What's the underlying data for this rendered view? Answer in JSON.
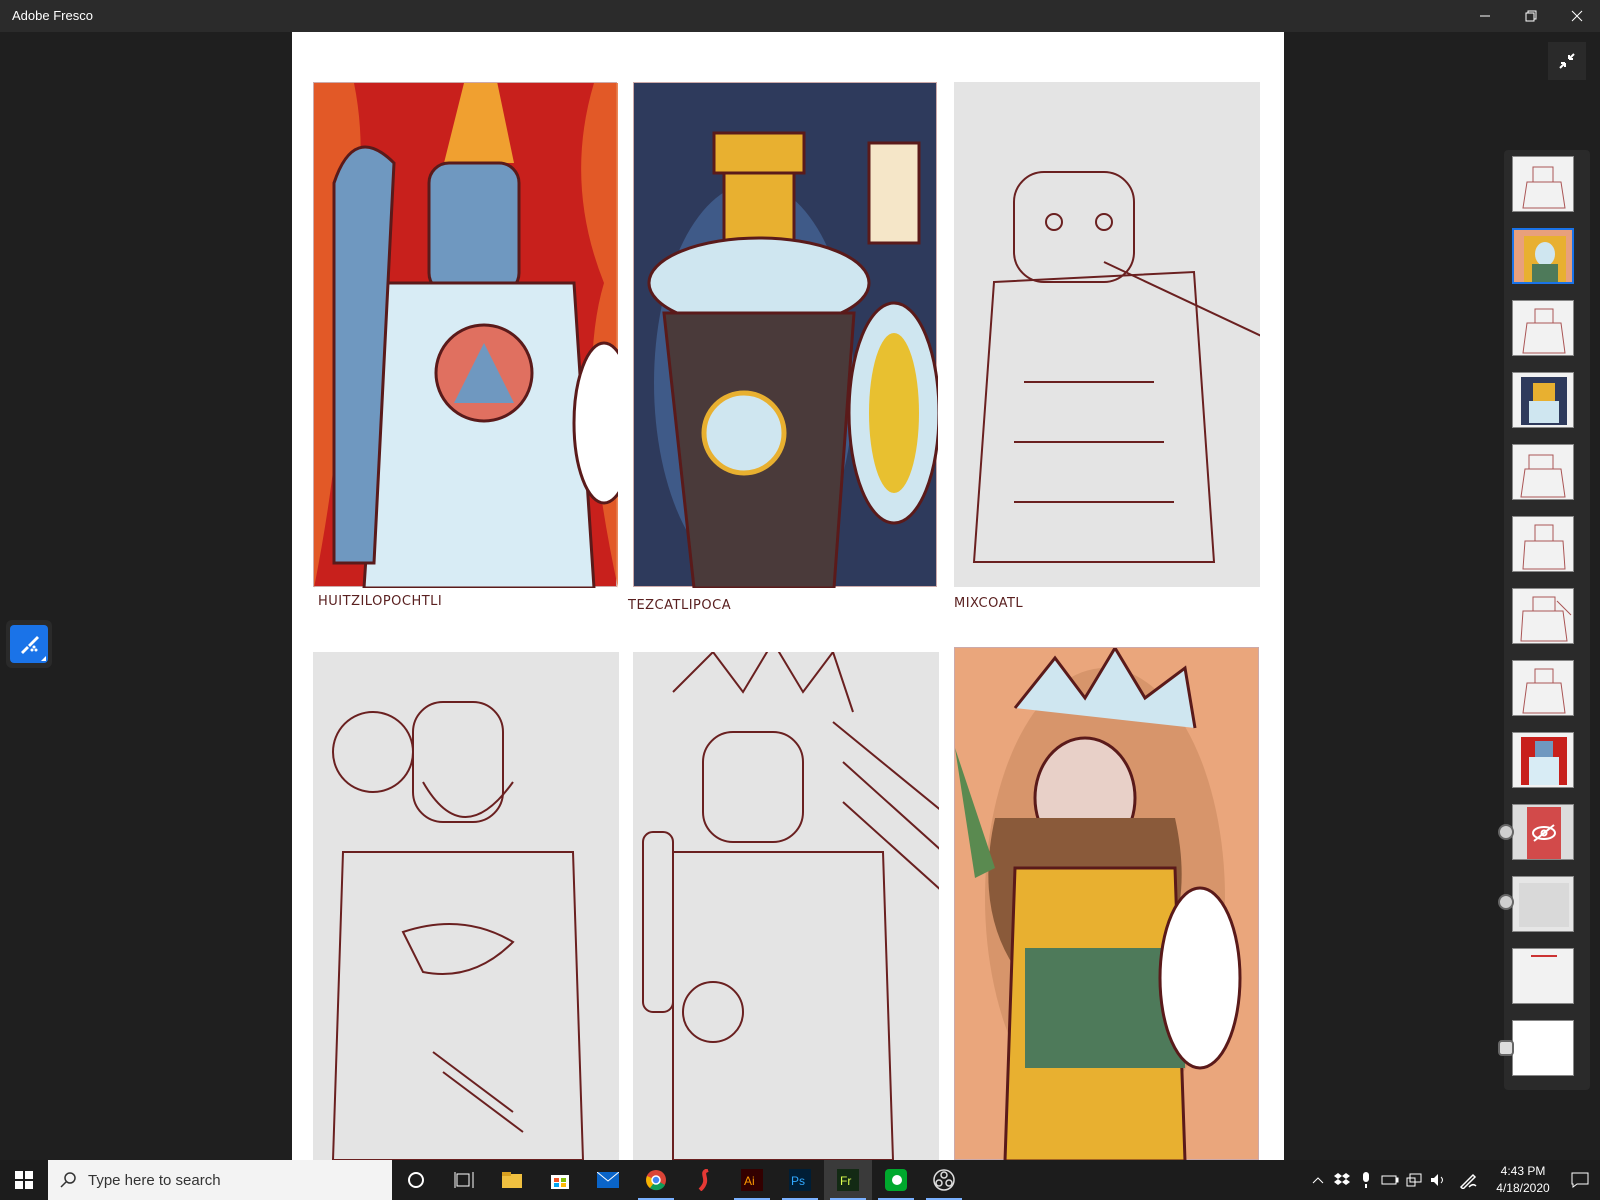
{
  "window": {
    "title": "Adobe Fresco"
  },
  "canvas": {
    "panels": [
      {
        "name": "huitzilopochtli",
        "caption": "HUITZILOPOCHTLI",
        "fill": "#c8201c"
      },
      {
        "name": "tezcatlipoca",
        "caption": "TEZCATLIPOCA",
        "fill": "#2e3a5c"
      },
      {
        "name": "mixcoatl",
        "caption": "MIXCOATL",
        "fill": "#e4e4e4"
      },
      {
        "name": "lineart-bottom-left",
        "caption": "",
        "fill": "#e4e4e4"
      },
      {
        "name": "lineart-bottom-middle",
        "caption": "",
        "fill": "#e4e4e4"
      },
      {
        "name": "colored-bottom-right",
        "caption": "",
        "fill": "#eaa67c"
      }
    ]
  },
  "layers": {
    "count": 13,
    "selected_index": 1,
    "hidden_index": 9
  },
  "taskbar": {
    "search_placeholder": "Type here to search",
    "apps": [
      "cortana-icon",
      "task-view-icon",
      "file-explorer-icon",
      "store-icon",
      "mail-icon",
      "chrome-icon",
      "sketchbook-icon",
      "illustrator-icon",
      "photoshop-icon",
      "fresco-icon",
      "evernote-icon",
      "obs-icon"
    ],
    "active_app": "fresco-icon",
    "clock_time": "4:43 PM",
    "clock_date": "4/18/2020"
  },
  "colors": {
    "accent": "#1a73e8",
    "titlebar": "#2b2b2b",
    "taskbar": "#1c1c1c"
  }
}
